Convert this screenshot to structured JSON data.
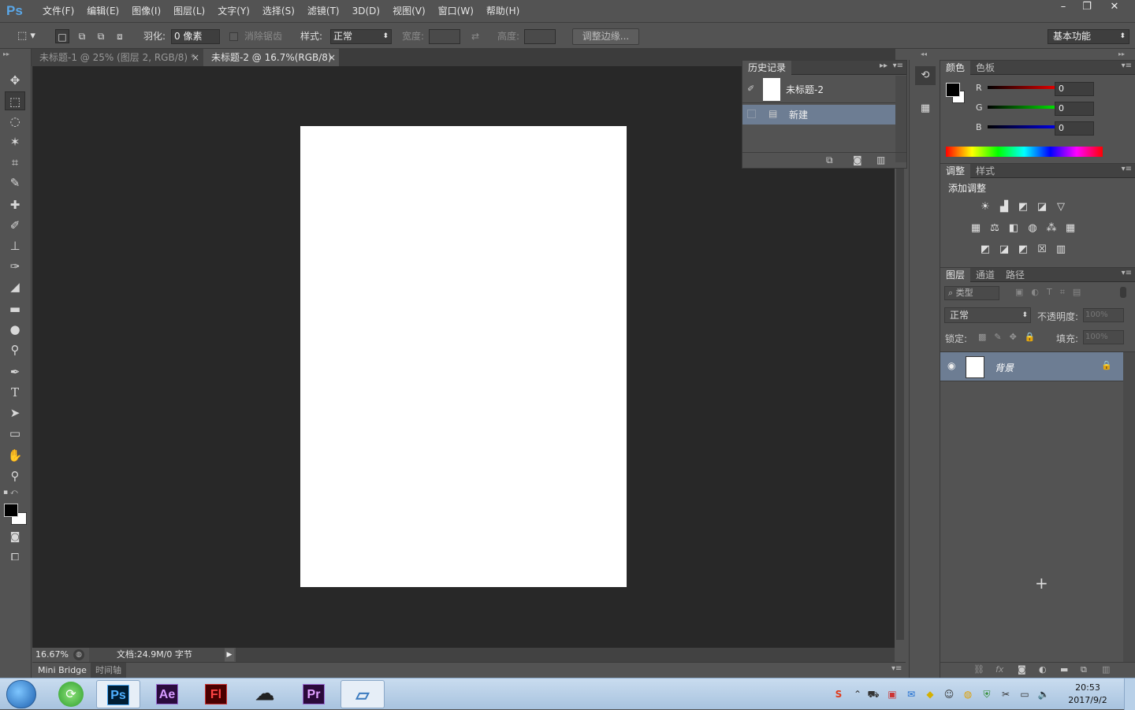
{
  "app": {
    "logo": "Ps"
  },
  "menu": [
    "文件(F)",
    "编辑(E)",
    "图像(I)",
    "图层(L)",
    "文字(Y)",
    "选择(S)",
    "滤镜(T)",
    "3D(D)",
    "视图(V)",
    "窗口(W)",
    "帮助(H)"
  ],
  "window_controls": {
    "minimize": "–",
    "restore": "❐",
    "close": "✕"
  },
  "options": {
    "feather_label": "羽化:",
    "feather_value": "0 像素",
    "antialias_label": "消除锯齿",
    "style_label": "样式:",
    "style_value": "正常",
    "width_label": "宽度:",
    "height_label": "高度:",
    "refine_edge": "调整边缘...",
    "workspace": "基本功能"
  },
  "tabs": [
    {
      "label": "未标题-1 @ 25% (图层 2, RGB/8) *",
      "close": "×"
    },
    {
      "label": "未标题-2 @ 16.7%(RGB/8)",
      "close": "×"
    }
  ],
  "history": {
    "tab": "历史记录",
    "snapshot": "未标题-2",
    "items": [
      "新建"
    ]
  },
  "color_panel": {
    "tabs": [
      "颜色",
      "色板"
    ],
    "r_label": "R",
    "g_label": "G",
    "b_label": "B",
    "r": "0",
    "g": "0",
    "b": "0"
  },
  "adjust_panel": {
    "tabs": [
      "调整",
      "样式"
    ],
    "title": "添加调整"
  },
  "layers_panel": {
    "tabs": [
      "图层",
      "通道",
      "路径"
    ],
    "filter_kind": "类型",
    "blend_mode": "正常",
    "opacity_label": "不透明度:",
    "opacity_value": "100%",
    "lock_label": "锁定:",
    "fill_label": "填充:",
    "fill_value": "100%",
    "layers": [
      {
        "name": "背景",
        "visible": true,
        "locked": true
      }
    ]
  },
  "status": {
    "zoom": "16.67%",
    "doc_info": "文档:24.9M/0 字节"
  },
  "bottom_tabs": [
    "Mini Bridge",
    "时间轴"
  ],
  "taskbar": {
    "apps": [
      "Ps",
      "Ae",
      "Fl",
      "Pr"
    ],
    "time": "20:53",
    "date": "2017/9/2"
  },
  "colors": {
    "accent": "#5aa7e8",
    "ps_blue": "#001d34",
    "ae_purple": "#2a0b3d",
    "fl_red": "#4a0000",
    "pr_purple": "#2a0a3a"
  }
}
